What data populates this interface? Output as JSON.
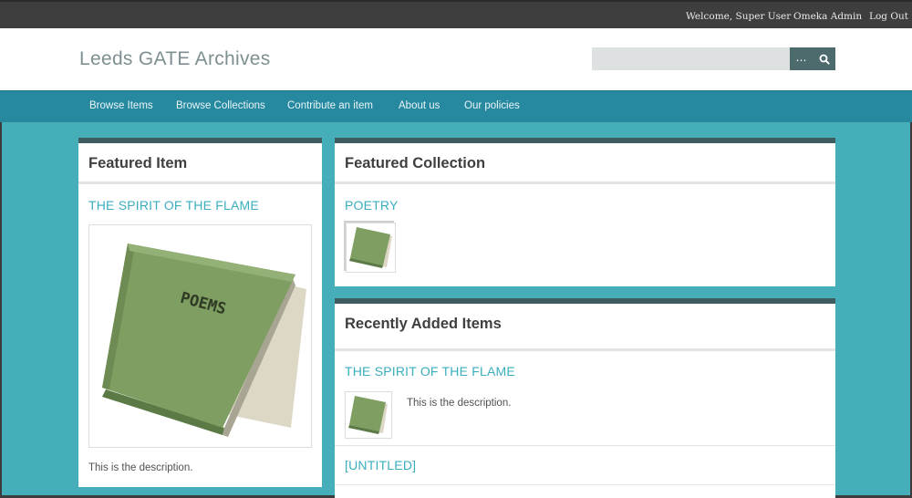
{
  "admin_bar": {
    "welcome": "Welcome, Super User",
    "admin_link": "Omeka Admin",
    "logout": "Log Out"
  },
  "header": {
    "site_title": "Leeds GATE Archives",
    "search": {
      "value": "",
      "placeholder": "",
      "advanced_label": "…",
      "submit_icon": "search-icon"
    }
  },
  "nav": {
    "items": [
      {
        "label": "Browse Items"
      },
      {
        "label": "Browse Collections"
      },
      {
        "label": "Contribute an item"
      },
      {
        "label": "About us"
      },
      {
        "label": "Our policies"
      }
    ]
  },
  "featured_item": {
    "heading": "Featured Item",
    "title": "THE SPIRIT OF THE FLAME",
    "book_label": "POEMS",
    "description": "This is the description."
  },
  "featured_collection": {
    "heading": "Featured Collection",
    "title": "POETRY"
  },
  "recent_items": {
    "heading": "Recently Added Items",
    "items": [
      {
        "title": "THE SPIRIT OF THE FLAME",
        "description": "This is the description."
      },
      {
        "title": "[UNTITLED]"
      }
    ]
  },
  "colors": {
    "page_bg": "#45aeb8",
    "nav_bg": "#2789a0",
    "admin_bg": "#3e3e3e",
    "link": "#3aaebf",
    "panel_border": "#3f5d60",
    "book_green": "#7f9e62"
  }
}
